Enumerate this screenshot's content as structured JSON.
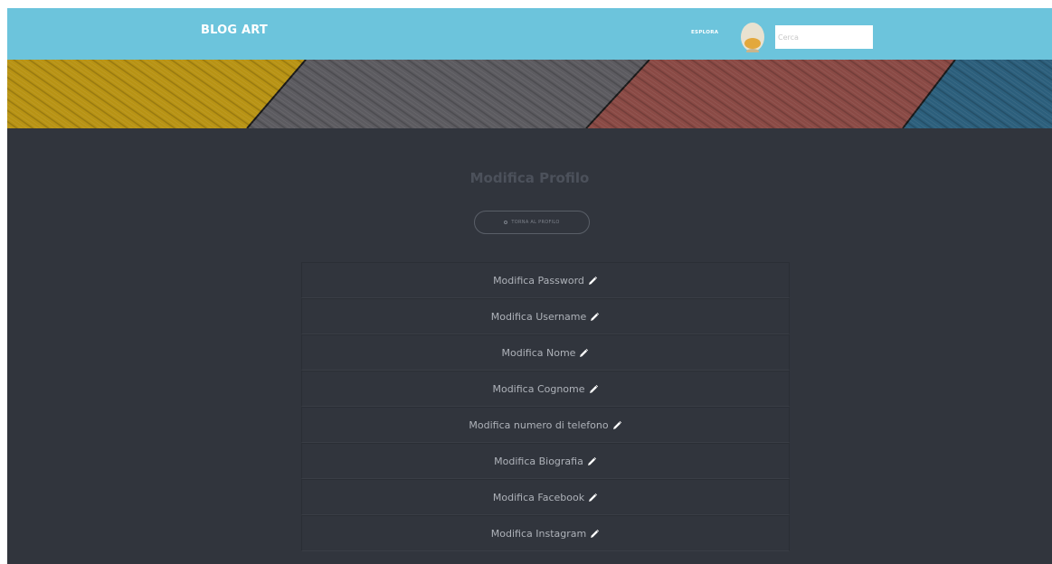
{
  "navbar": {
    "brand": "BLOG ART",
    "explore_label": "ESPLORA",
    "search_placeholder": "Cerca",
    "background": "#6cc4dc"
  },
  "main": {
    "title": "Modifica Profilo",
    "back_button_label": "TORNA AL PROFILO",
    "items": [
      {
        "label": "Modifica Password",
        "icon": "pencil-icon"
      },
      {
        "label": "Modifica Username",
        "icon": "pencil-icon"
      },
      {
        "label": "Modifica Nome",
        "icon": "pencil-icon"
      },
      {
        "label": "Modifica Cognome",
        "icon": "pencil-icon"
      },
      {
        "label": "Modifica numero di telefono",
        "icon": "pencil-icon"
      },
      {
        "label": "Modifica Biografia",
        "icon": "pencil-icon"
      },
      {
        "label": "Modifica Facebook",
        "icon": "pencil-icon"
      },
      {
        "label": "Modifica Instagram",
        "icon": "pencil-icon"
      }
    ],
    "background": "#31353d"
  },
  "banner": {
    "colors": [
      "#b89314",
      "#5c5b60",
      "#8a4a45",
      "#2c5f7c"
    ]
  }
}
